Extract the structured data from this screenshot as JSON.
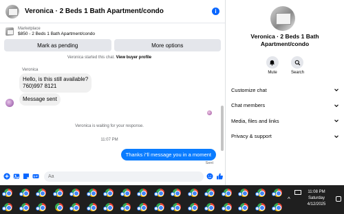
{
  "chat": {
    "title": "Veronica · 2 Beds 1 Bath Apartment/condo",
    "listing": {
      "category": "Marketplace",
      "price_title": "$850 - 2 Beds 1 Bath Apartment/condo"
    },
    "actions": {
      "mark_pending": "Mark as pending",
      "more_options": "More options"
    },
    "system_started": "Veronica started this chat.",
    "view_buyer_profile": "View buyer profile",
    "sender_name": "Veronica",
    "incoming": [
      {
        "line1": "Hello, is this still available?",
        "line2": "760)997 8121"
      },
      {
        "line1": "Message sent"
      }
    ],
    "waiting_text": "Veronica is waiting for your response.",
    "time_divider": "11:07 PM",
    "outgoing": "Thanks i\"ll message you in a moment",
    "sent_status": "Sent",
    "composer_placeholder": "Aa"
  },
  "info": {
    "title": "Veronica · 2 Beds 1 Bath Apartment/condo",
    "mute_label": "Mute",
    "search_label": "Search",
    "menu": [
      {
        "label": "Customize chat"
      },
      {
        "label": "Chat members"
      },
      {
        "label": "Media, files and links"
      },
      {
        "label": "Privacy & support"
      }
    ]
  },
  "taskbar": {
    "time": "11:08 PM",
    "day": "Saturday",
    "date": "4/12/2025"
  },
  "colors": {
    "accent": "#0866ff",
    "bubble_out": "#0a7cff",
    "bubble_in": "#f0f0f0",
    "taskbar": "#1f1f1f"
  }
}
